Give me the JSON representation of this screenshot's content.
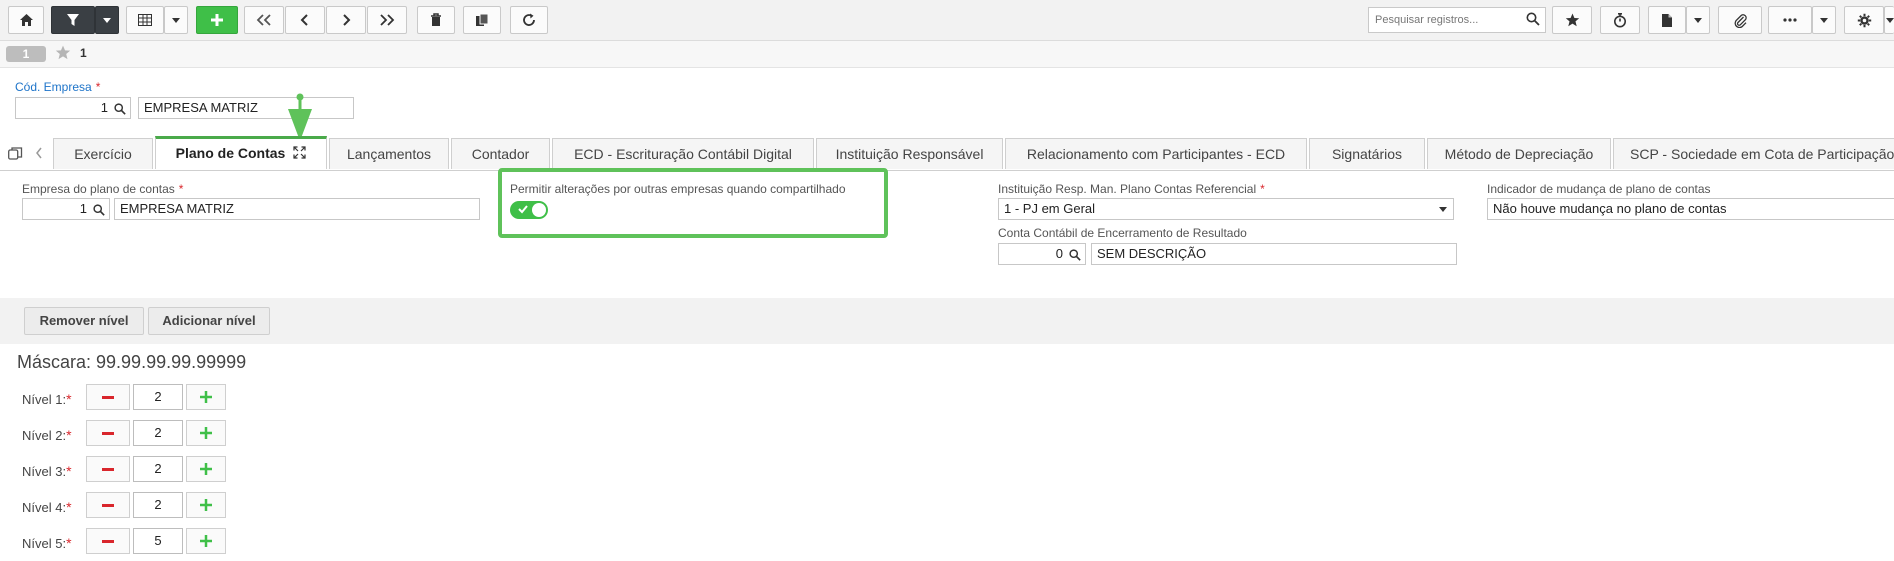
{
  "toolbar": {
    "search_placeholder": "Pesquisar registros..."
  },
  "record": {
    "pill": "1",
    "number": "1"
  },
  "header": {
    "cod_empresa_label": "Cód. Empresa",
    "cod_empresa_value": "1",
    "empresa_name": "EMPRESA MATRIZ"
  },
  "tabs": [
    {
      "label": "Exercício"
    },
    {
      "label": "Plano de Contas"
    },
    {
      "label": "Lançamentos"
    },
    {
      "label": "Contador"
    },
    {
      "label": "ECD - Escrituração Contábil Digital"
    },
    {
      "label": "Instituição Responsável"
    },
    {
      "label": "Relacionamento com Participantes - ECD"
    },
    {
      "label": "Signatários"
    },
    {
      "label": "Método de Depreciação"
    },
    {
      "label": "SCP - Sociedade em Cota de Participação"
    }
  ],
  "form": {
    "empresa_plano_label": "Empresa do plano de contas",
    "empresa_plano_code": "1",
    "empresa_plano_name": "EMPRESA MATRIZ",
    "permitir_label": "Permitir alterações por outras empresas quando compartilhado",
    "permitir_value": "on",
    "instituicao_label": "Instituição Resp. Man. Plano Contas Referencial",
    "instituicao_value": "1 - PJ em Geral",
    "conta_label": "Conta Contábil de Encerramento de Resultado",
    "conta_code": "0",
    "conta_desc": "SEM DESCRIÇÃO",
    "indicador_label": "Indicador de mudança de plano de contas",
    "indicador_value": "Não houve mudança no plano de contas"
  },
  "levels": {
    "remove_label": "Remover nível",
    "add_label": "Adicionar nível",
    "mask_label": "Máscara: 99.99.99.99.99999",
    "items": [
      {
        "label": "Nível 1:",
        "value": "2"
      },
      {
        "label": "Nível 2:",
        "value": "2"
      },
      {
        "label": "Nível 3:",
        "value": "2"
      },
      {
        "label": "Nível 4:",
        "value": "2"
      },
      {
        "label": "Nível 5:",
        "value": "5"
      }
    ]
  },
  "colors": {
    "accent_green": "#3fbf48",
    "highlight_green": "#5fc25a",
    "required_red": "#d9262c",
    "label_blue": "#1e74c9"
  }
}
